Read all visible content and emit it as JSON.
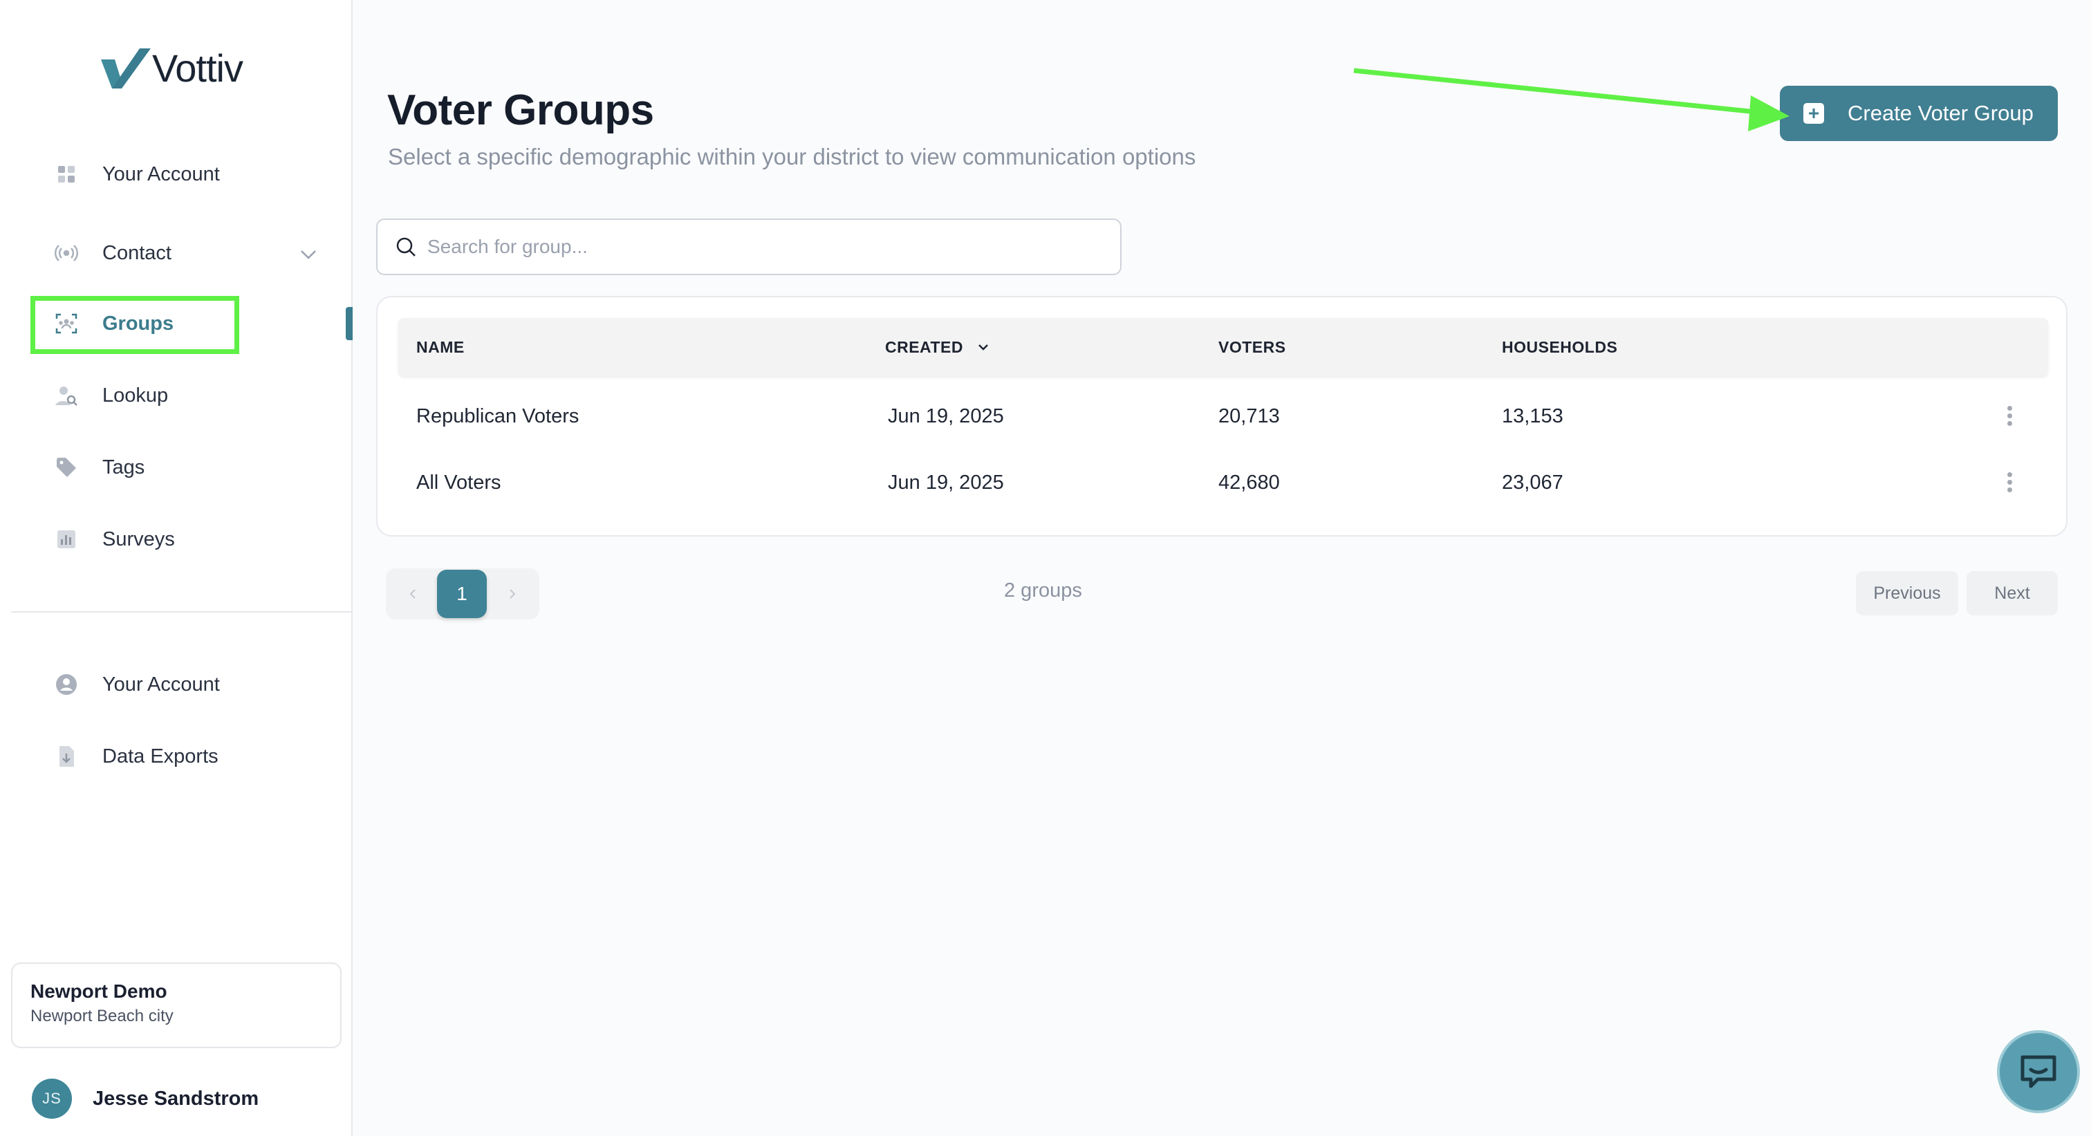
{
  "brand": {
    "name": "Vottiv"
  },
  "sidebar": {
    "items": [
      {
        "label": "Your Account",
        "icon": "dashboard-grid-icon"
      },
      {
        "label": "Contact",
        "icon": "broadcast-icon"
      },
      {
        "label": "Groups",
        "icon": "group-scan-icon",
        "active": true
      },
      {
        "label": "Lookup",
        "icon": "person-search-icon"
      },
      {
        "label": "Tags",
        "icon": "tag-icon"
      },
      {
        "label": "Surveys",
        "icon": "bar-chart-icon"
      }
    ],
    "secondary": [
      {
        "label": "Your Account",
        "icon": "user-circle-icon"
      },
      {
        "label": "Data Exports",
        "icon": "file-download-icon"
      }
    ],
    "org": {
      "name": "Newport Demo",
      "subtitle": "Newport Beach city"
    },
    "user": {
      "initials": "JS",
      "name": "Jesse Sandstrom"
    }
  },
  "header": {
    "title": "Voter Groups",
    "subtitle": "Select a specific demographic within your district to view communication options",
    "create_button": "Create Voter Group"
  },
  "search": {
    "placeholder": "Search for group..."
  },
  "table": {
    "columns": [
      "NAME",
      "CREATED",
      "VOTERS",
      "HOUSEHOLDS"
    ],
    "sort_column": "CREATED",
    "rows": [
      {
        "name": "Republican Voters",
        "created": "Jun 19, 2025",
        "voters": "20,713",
        "households": "13,153"
      },
      {
        "name": "All Voters",
        "created": "Jun 19, 2025",
        "voters": "42,680",
        "households": "23,067"
      }
    ]
  },
  "pagination": {
    "current_page": "1",
    "count_text": "2 groups",
    "previous_label": "Previous",
    "next_label": "Next"
  },
  "colors": {
    "accent": "#417f92",
    "highlight": "#5ff046",
    "page_bg": "#fafbfc"
  }
}
